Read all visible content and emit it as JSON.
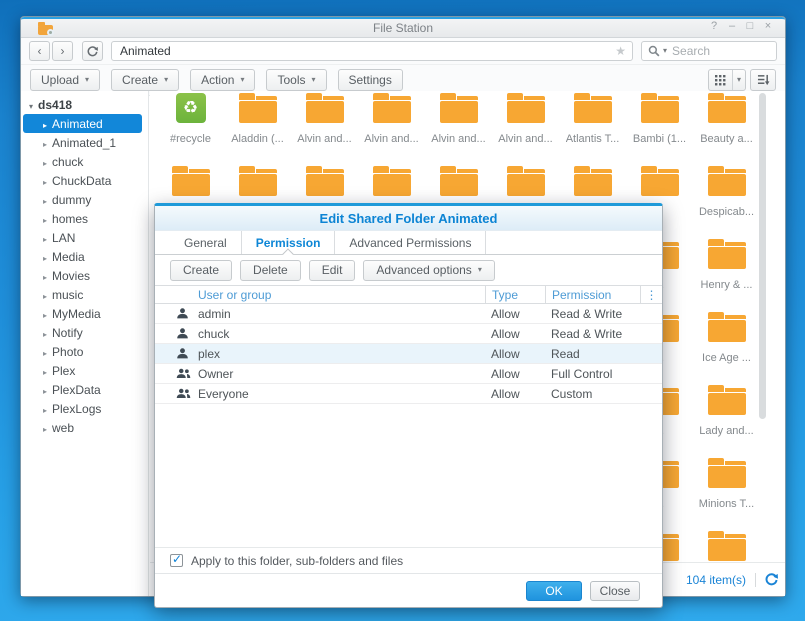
{
  "icons": {
    "back": "‹",
    "forward": "›",
    "star": "★",
    "caret_down": "▾",
    "check": "✓",
    "column_menu": "⋮",
    "recycle": "♻"
  },
  "window": {
    "title": "File Station",
    "controls": [
      {
        "name": "help",
        "glyph": "?"
      },
      {
        "name": "minimize",
        "glyph": "–"
      },
      {
        "name": "maximize",
        "glyph": "□"
      },
      {
        "name": "close",
        "glyph": "×"
      }
    ],
    "toolbar": {
      "path_value": "Animated",
      "search_placeholder": "Search"
    },
    "menubar": [
      {
        "label": "Upload",
        "dropdown": true
      },
      {
        "label": "Create",
        "dropdown": true
      },
      {
        "label": "Action",
        "dropdown": true
      },
      {
        "label": "Tools",
        "dropdown": true
      },
      {
        "label": "Settings",
        "dropdown": false
      }
    ],
    "sidebar": {
      "root": {
        "label": "ds418"
      },
      "items": [
        {
          "label": "Animated",
          "selected": true
        },
        {
          "label": "Animated_1"
        },
        {
          "label": "chuck"
        },
        {
          "label": "ChuckData"
        },
        {
          "label": "dummy"
        },
        {
          "label": "homes"
        },
        {
          "label": "LAN"
        },
        {
          "label": "Media"
        },
        {
          "label": "Movies"
        },
        {
          "label": "music"
        },
        {
          "label": "MyMedia"
        },
        {
          "label": "Notify"
        },
        {
          "label": "Photo"
        },
        {
          "label": "Plex"
        },
        {
          "label": "PlexData"
        },
        {
          "label": "PlexLogs"
        },
        {
          "label": "web"
        }
      ]
    },
    "grid": {
      "rows": [
        {
          "cells": [
            {
              "label": "#recycle",
              "recycle": true
            },
            {
              "label": "Aladdin (..."
            },
            {
              "label": "Alvin and..."
            },
            {
              "label": "Alvin and..."
            },
            {
              "label": "Alvin and..."
            },
            {
              "label": "Alvin and..."
            },
            {
              "label": "Atlantis T..."
            },
            {
              "label": "Bambi (1..."
            },
            {
              "label": "Beauty a..."
            }
          ]
        },
        {
          "cells": [
            {
              "label": ""
            },
            {
              "label": ""
            },
            {
              "label": ""
            },
            {
              "label": ""
            },
            {
              "label": ""
            },
            {
              "label": ""
            },
            {
              "label": ""
            },
            {
              "label": ""
            },
            {
              "label": "Despicab..."
            }
          ]
        },
        {
          "cells": [
            {
              "label": ""
            },
            {
              "label": ""
            },
            {
              "label": ""
            },
            {
              "label": ""
            },
            {
              "label": ""
            },
            {
              "label": ""
            },
            {
              "label": ""
            },
            {
              "label": "..."
            },
            {
              "label": "Henry & ..."
            }
          ]
        },
        {
          "cells": [
            {
              "label": ""
            },
            {
              "label": ""
            },
            {
              "label": ""
            },
            {
              "label": ""
            },
            {
              "label": ""
            },
            {
              "label": ""
            },
            {
              "label": ""
            },
            {
              "label": "..."
            },
            {
              "label": "Ice Age ..."
            }
          ]
        },
        {
          "cells": [
            {
              "label": ""
            },
            {
              "label": ""
            },
            {
              "label": ""
            },
            {
              "label": ""
            },
            {
              "label": ""
            },
            {
              "label": ""
            },
            {
              "label": ""
            },
            {
              "label": "..."
            },
            {
              "label": "Lady and..."
            }
          ]
        },
        {
          "cells": [
            {
              "label": ""
            },
            {
              "label": ""
            },
            {
              "label": ""
            },
            {
              "label": ""
            },
            {
              "label": ""
            },
            {
              "label": ""
            },
            {
              "label": ""
            },
            {
              "label": "..."
            },
            {
              "label": "Minions T..."
            }
          ]
        },
        {
          "cells": [
            {
              "label": ""
            },
            {
              "label": ""
            },
            {
              "label": ""
            },
            {
              "label": ""
            },
            {
              "label": ""
            },
            {
              "label": ""
            },
            {
              "label": ""
            },
            {
              "label": ""
            },
            {
              "label": ""
            }
          ]
        }
      ]
    },
    "status": {
      "count_label": "104 item(s)"
    }
  },
  "dialog": {
    "title": "Edit Shared Folder Animated",
    "tabs": [
      {
        "label": "General"
      },
      {
        "label": "Permission",
        "active": true
      },
      {
        "label": "Advanced Permissions"
      }
    ],
    "toolbar": [
      {
        "label": "Create"
      },
      {
        "label": "Delete"
      },
      {
        "label": "Edit"
      },
      {
        "label": "Advanced options",
        "dropdown": true
      }
    ],
    "table": {
      "columns": [
        "User or group",
        "Type",
        "Permission"
      ],
      "rows": [
        {
          "name": "admin",
          "group": false,
          "type": "Allow",
          "permission": "Read & Write"
        },
        {
          "name": "chuck",
          "group": false,
          "type": "Allow",
          "permission": "Read & Write"
        },
        {
          "name": "plex",
          "group": false,
          "type": "Allow",
          "permission": "Read",
          "selected": true
        },
        {
          "name": "Owner",
          "group": true,
          "type": "Allow",
          "permission": "Full Control"
        },
        {
          "name": "Everyone",
          "group": true,
          "type": "Allow",
          "permission": "Custom"
        }
      ]
    },
    "checkbox": {
      "checked": true,
      "label": "Apply to this folder, sub-folders and files"
    },
    "footer": {
      "ok_label": "OK",
      "close_label": "Close"
    }
  }
}
